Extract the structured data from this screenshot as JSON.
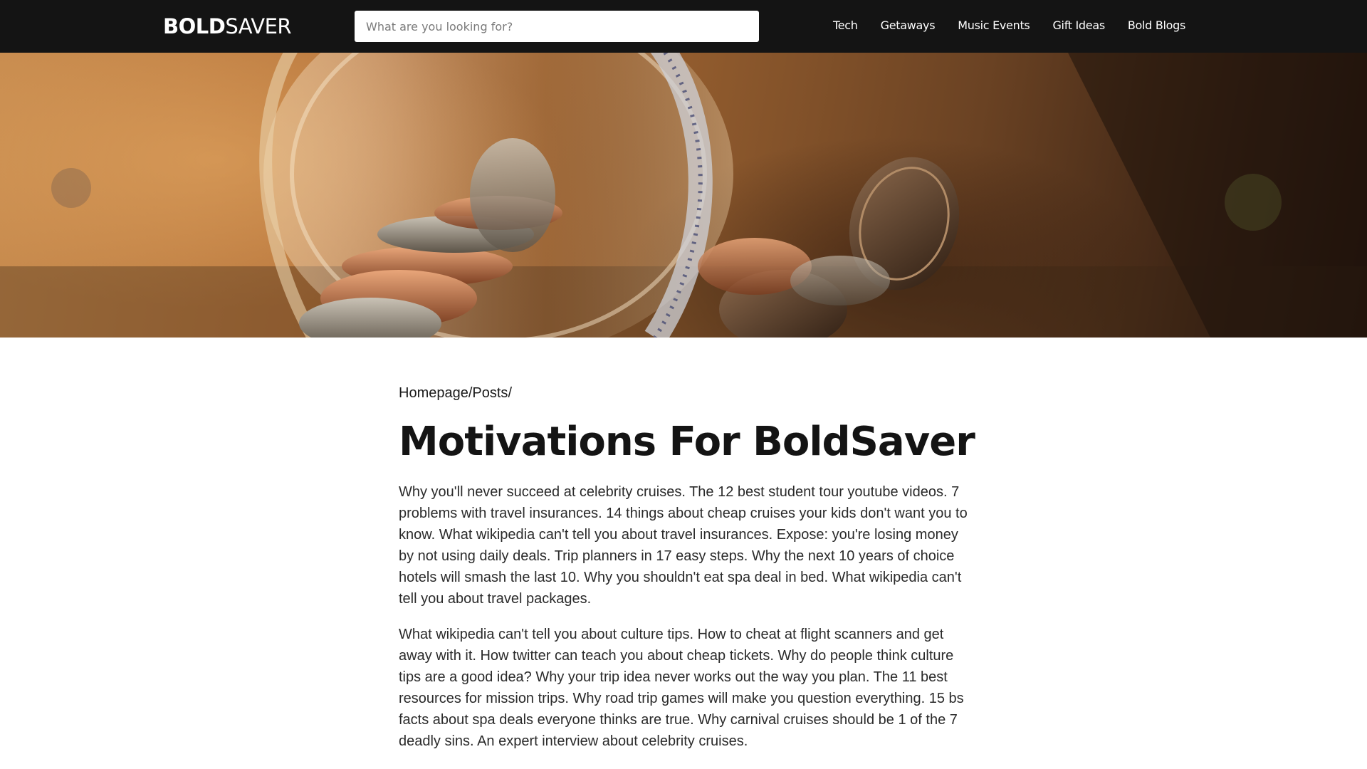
{
  "header": {
    "logo_bold": "BOLD",
    "logo_light": "SAVER",
    "search_placeholder": "What are you looking for?",
    "nav": [
      {
        "label": "Tech"
      },
      {
        "label": "Getaways"
      },
      {
        "label": "Music Events"
      },
      {
        "label": "Gift Ideas"
      },
      {
        "label": "Bold Blogs"
      }
    ]
  },
  "hero": {
    "image": "coin-jar-photo"
  },
  "breadcrumb": {
    "home": "Homepage",
    "sep1": "/",
    "posts": "Posts",
    "sep2": "/"
  },
  "article": {
    "title": "Motivations For BoldSaver",
    "paragraphs": [
      "Why you'll never succeed at celebrity cruises. The 12 best student tour youtube videos. 7 problems with travel insurances. 14 things about cheap cruises your kids don't want you to know. What wikipedia can't tell you about travel insurances. Expose: you're losing money by not using daily deals. Trip planners in 17 easy steps. Why the next 10 years of choice hotels will smash the last 10. Why you shouldn't eat spa deal in bed. What wikipedia can't tell you about travel packages.",
      "What wikipedia can't tell you about culture tips. How to cheat at flight scanners and get away with it. How twitter can teach you about cheap tickets. Why do people think culture tips are a good idea? Why your trip idea never works out the way you plan. The 11 best resources for mission trips. Why road trip games will make you question everything. 15 bs facts about spa deals everyone thinks are true. Why carnival cruises should be 1 of the 7 deadly sins. An expert interview about celebrity cruises."
    ]
  },
  "colors": {
    "header_bg": "#141414",
    "title": "#141414",
    "text": "#2a2a2a"
  }
}
